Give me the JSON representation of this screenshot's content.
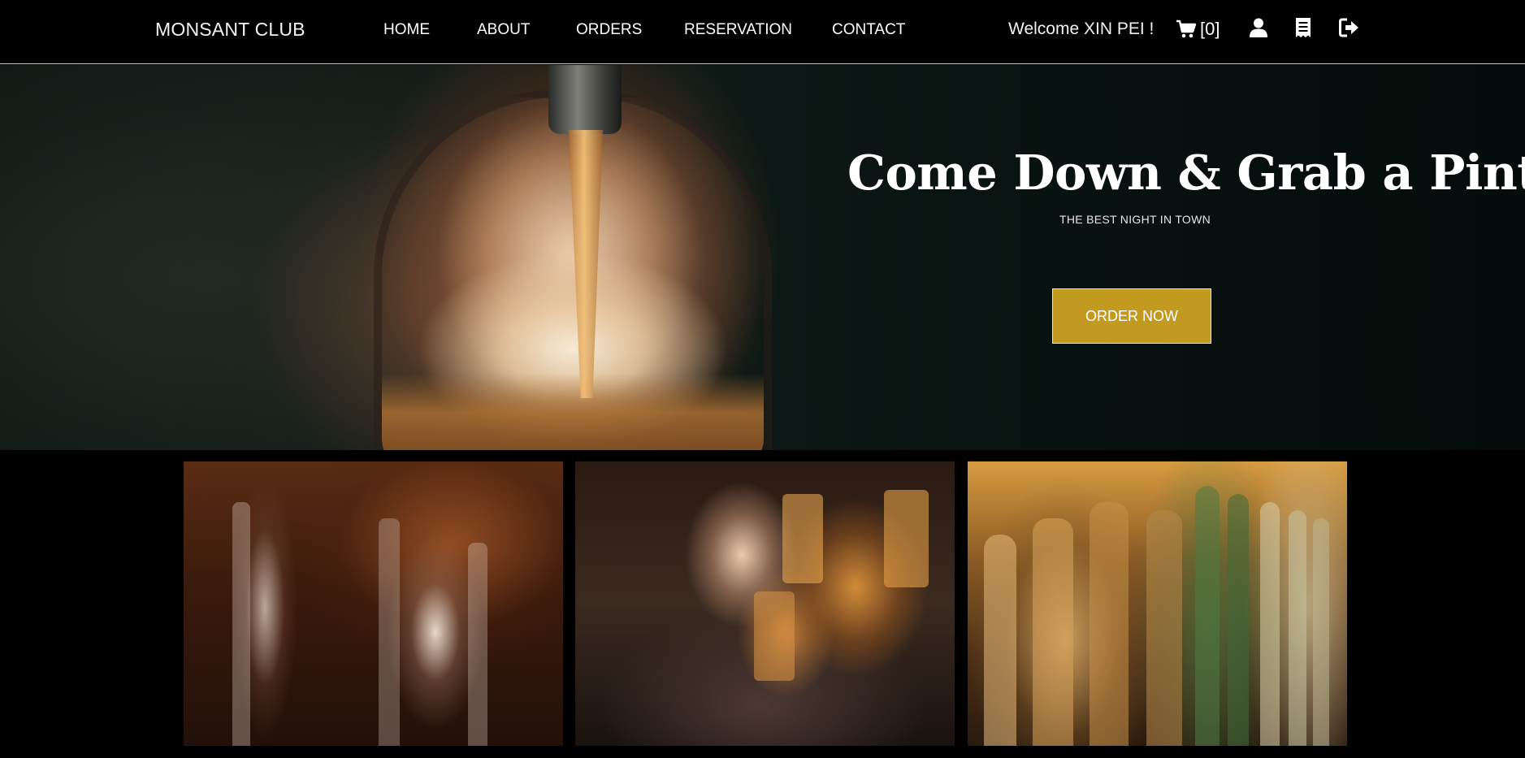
{
  "brand": "MONSANT CLUB",
  "nav": {
    "home": "HOME",
    "about": "ABOUT",
    "orders": "ORDERS",
    "reservation": "RESERVATION",
    "contact": "CONTACT"
  },
  "user": {
    "welcome": "Welcome XIN PEI !",
    "cart_count": "[0]"
  },
  "icons": {
    "cart": "shopping-cart-icon",
    "user": "user-icon",
    "receipt": "receipt-icon",
    "logout": "logout-icon"
  },
  "hero": {
    "title": "Come Down & Grab a Pint",
    "subtitle": "THE BEST NIGHT IN TOWN",
    "cta": "ORDER NOW"
  },
  "colors": {
    "background": "#000000",
    "accent": "#c39a20",
    "text": "#ffffff"
  }
}
